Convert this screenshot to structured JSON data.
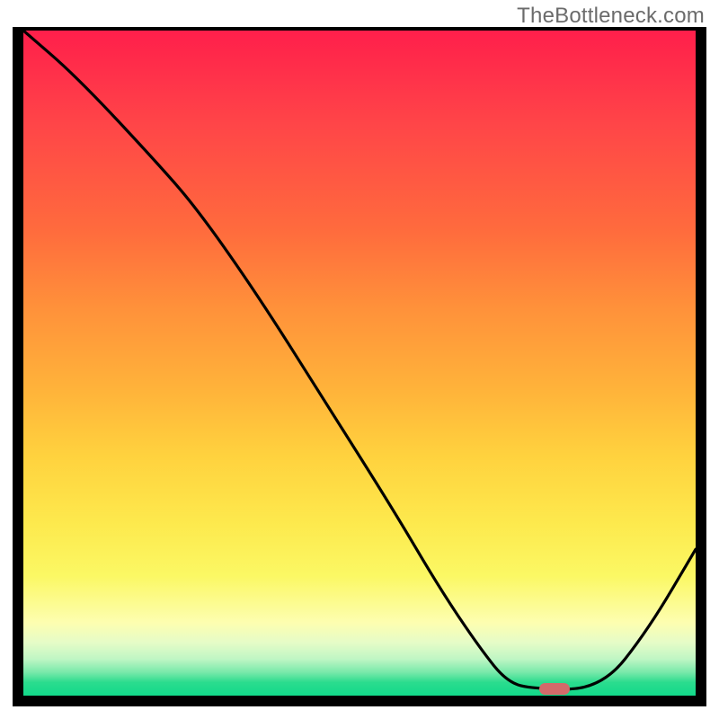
{
  "watermark": "TheBottleneck.com",
  "chart_data": {
    "type": "line",
    "title": "",
    "xlabel": "",
    "ylabel": "",
    "xlim": [
      0,
      100
    ],
    "ylim": [
      0,
      100
    ],
    "grid": false,
    "legend": false,
    "series": [
      {
        "name": "bottleneck-curve",
        "x": [
          0,
          8,
          20,
          26,
          35,
          45,
          55,
          62,
          68,
          72,
          76,
          86,
          93,
          100
        ],
        "values": [
          100,
          93,
          80,
          73,
          60,
          44,
          28,
          16,
          7,
          2,
          1,
          1,
          10,
          22
        ]
      }
    ],
    "marker": {
      "name": "optimal-point",
      "x": 79,
      "y": 1,
      "width": 4.5,
      "height": 1.8,
      "color": "#d46a6a"
    },
    "background_gradient": {
      "stops": [
        {
          "pos": 0,
          "color": "#ff1f4b"
        },
        {
          "pos": 0.3,
          "color": "#ff6b3d"
        },
        {
          "pos": 0.55,
          "color": "#ffc03c"
        },
        {
          "pos": 0.78,
          "color": "#fdf45a"
        },
        {
          "pos": 0.9,
          "color": "#fdfeb0"
        },
        {
          "pos": 1.0,
          "color": "#12d98a"
        }
      ]
    }
  }
}
